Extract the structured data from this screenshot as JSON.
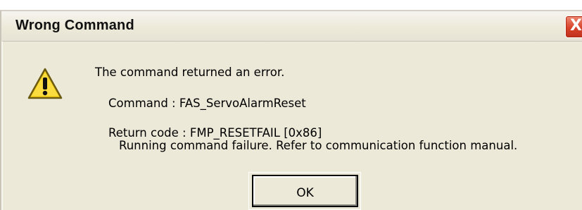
{
  "dialog": {
    "title": "Wrong Command",
    "close_label": "X",
    "icon": "warning-icon",
    "message_line1": "The command returned an error.",
    "message_line2": "Command : FAS_ServoAlarmReset",
    "message_line3": "Return code : FMP_RESETFAIL [0x86]",
    "message_line4": "Running command failure. Refer to communication function manual.",
    "ok_label": "OK"
  },
  "colors": {
    "dialog_bg": "#ece9d8",
    "close_red": "#d7432a",
    "warning_yellow": "#f7d21a"
  }
}
